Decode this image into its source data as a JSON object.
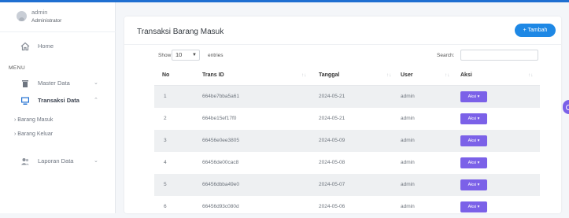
{
  "user": {
    "name": "admin",
    "role": "Administrator"
  },
  "sidebar": {
    "home_label": "Home",
    "menu_header": "MENU",
    "items": [
      {
        "label": "Master Data",
        "icon": "trash-icon",
        "chevron": "⌄"
      },
      {
        "label": "Transaksi Data",
        "icon": "monitor-icon",
        "chevron": "⌃"
      },
      {
        "label": "Laporan Data",
        "icon": "users-icon",
        "chevron": "⌄"
      }
    ],
    "sub_items": [
      "Barang Masuk",
      "Barang Keluar"
    ],
    "sub_bullet": "›"
  },
  "card": {
    "title": "Transaksi Barang Masuk",
    "add_button": "+ Tambah"
  },
  "table_controls": {
    "show_label": "Show",
    "entries_value": "10",
    "entries_label": "entries",
    "search_label": "Search:"
  },
  "table": {
    "columns": [
      "No",
      "Trans ID",
      "Tanggal",
      "User",
      "Aksi"
    ],
    "sort_glyph": "↑↓",
    "rows": [
      {
        "no": "1",
        "trans_id": "664be7bba5a61",
        "tanggal": "2024-05-21",
        "user": "admin",
        "aksi": "Aksi ▾"
      },
      {
        "no": "2",
        "trans_id": "664be15ef17f0",
        "tanggal": "2024-05-21",
        "user": "admin",
        "aksi": "Aksi ▾"
      },
      {
        "no": "3",
        "trans_id": "66456e0ee3805",
        "tanggal": "2024-05-09",
        "user": "admin",
        "aksi": "Aksi ▾"
      },
      {
        "no": "4",
        "trans_id": "66456de00cac8",
        "tanggal": "2024-05-08",
        "user": "admin",
        "aksi": "Aksi ▾"
      },
      {
        "no": "5",
        "trans_id": "66456dbba49e0",
        "tanggal": "2024-05-07",
        "user": "admin",
        "aksi": "Aksi ▾"
      },
      {
        "no": "6",
        "trans_id": "66456d93c080d",
        "tanggal": "2024-05-06",
        "user": "admin",
        "aksi": "Aksi ▾"
      }
    ]
  },
  "colors": {
    "primary": "#1e88e5",
    "action": "#7b61e8",
    "active_icon": "#1f6fd1"
  }
}
